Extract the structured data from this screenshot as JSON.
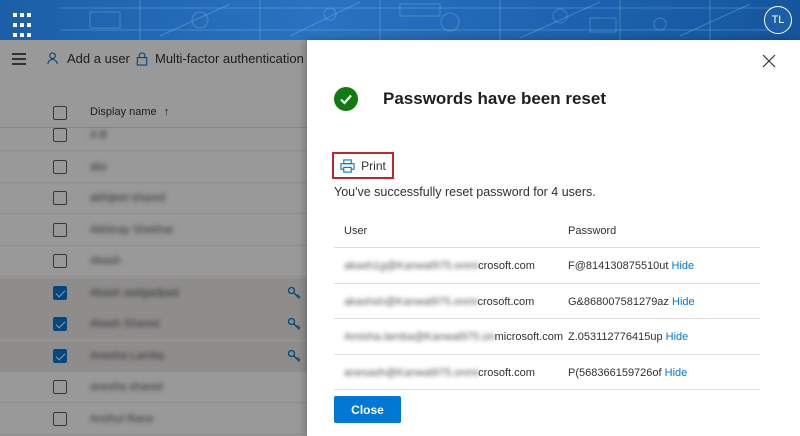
{
  "header": {
    "avatar_initials": "TL"
  },
  "commandbar": {
    "add_user_label": "Add a user",
    "mfa_label": "Multi-factor authentication"
  },
  "users_table": {
    "column_display_name": "Display name",
    "sort_indicator": "↑",
    "rows": [
      {
        "name": "A B",
        "selected": false,
        "key_icon": false
      },
      {
        "name": "abc",
        "selected": false,
        "key_icon": false
      },
      {
        "name": "abhijeet shared",
        "selected": false,
        "key_icon": false
      },
      {
        "name": "Abhinay Shekhar",
        "selected": false,
        "key_icon": false
      },
      {
        "name": "Akash",
        "selected": false,
        "key_icon": false
      },
      {
        "name": "Akash aadgadpad",
        "selected": true,
        "key_icon": true
      },
      {
        "name": "Akash Shared",
        "selected": true,
        "key_icon": true
      },
      {
        "name": "Anesha Lamba",
        "selected": true,
        "key_icon": true
      },
      {
        "name": "anesha shared",
        "selected": false,
        "key_icon": false
      },
      {
        "name": "Anshul Rana",
        "selected": false,
        "key_icon": false
      }
    ]
  },
  "panel": {
    "title": "Passwords have been reset",
    "print_label": "Print",
    "message": "You've successfully reset password for 4 users.",
    "col_user": "User",
    "col_password": "Password",
    "hide_label": "Hide",
    "rows": [
      {
        "user_blurred": "akash1g@Kanwal975.onmi",
        "user_visible": "crosoft.com",
        "password": "F@814130875510ut"
      },
      {
        "user_blurred": "akashsh@Kanwal975.onmi",
        "user_visible": "crosoft.com",
        "password": "G&868007581279az"
      },
      {
        "user_blurred": "Amisha.lamba@Kanwal975.on",
        "user_visible": "microsoft.com",
        "password": "Z.053112776415up"
      },
      {
        "user_blurred": "anesash@Kanwal975.onmi",
        "user_visible": "crosoft.com",
        "password": "P(568366159726of"
      }
    ],
    "close_label": "Close"
  },
  "colors": {
    "accent": "#0078d4",
    "success": "#107c10",
    "print_border": "#c0272d"
  }
}
